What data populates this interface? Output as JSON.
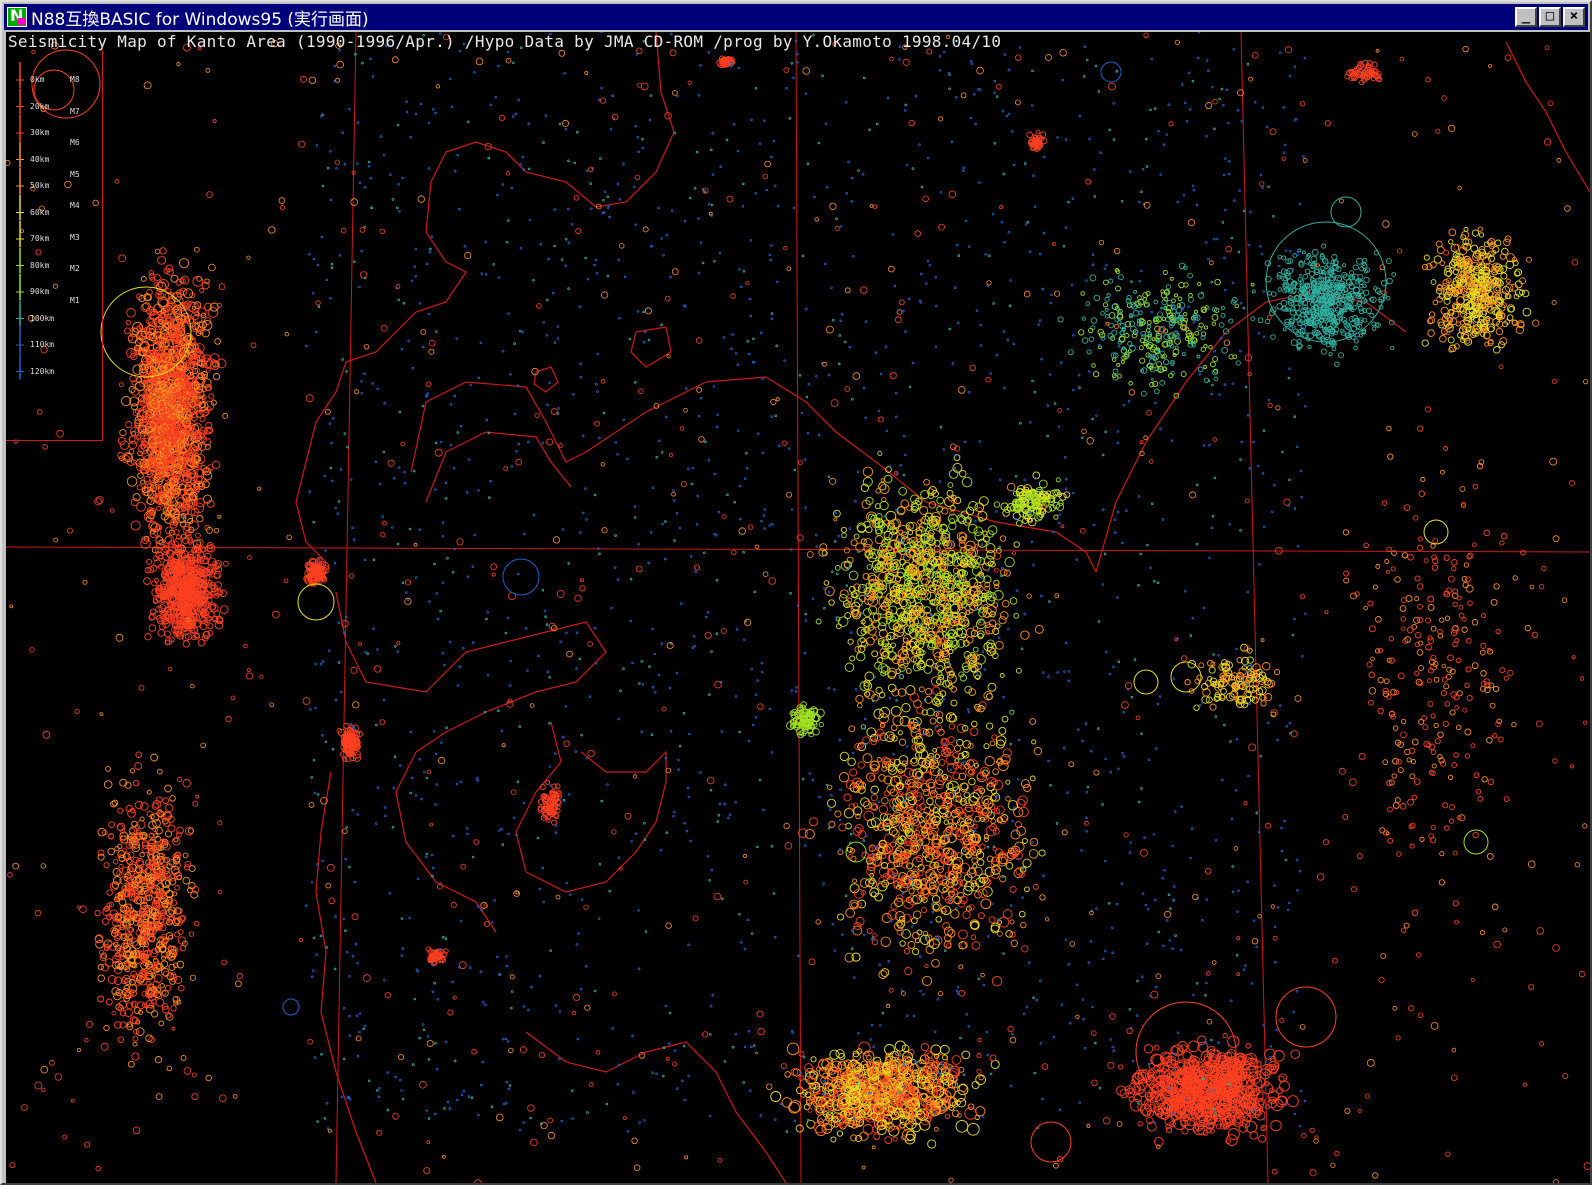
{
  "window": {
    "title": "N88互換BASIC for Windows95 (実行画面)",
    "controls": {
      "minimize": "_",
      "maximize": "□",
      "close": "×"
    }
  },
  "map": {
    "header": "Seismicity Map of Kanto Area (1990-1996/Apr.) /Hypo Data by JMA CD-ROM /prog by Y.Okamoto 1998.04/10",
    "legend": {
      "depth_labels": [
        "0km",
        "20km",
        "30km",
        "40km",
        "50km",
        "60km",
        "70km",
        "80km",
        "90km",
        "100km",
        "110km",
        "120km"
      ],
      "magnitude_labels": [
        "M8",
        "M7",
        "M6",
        "M5",
        "M4",
        "M3",
        "M2",
        "M1"
      ]
    },
    "colors": {
      "background": "#000000",
      "boundary": "#d01818",
      "shallow": "#ff4020",
      "mid_shallow": "#ff9020",
      "mid": "#e8e020",
      "mid_deep": "#a0e020",
      "deep": "#30b0a0",
      "deepest": "#2060d0"
    }
  }
}
